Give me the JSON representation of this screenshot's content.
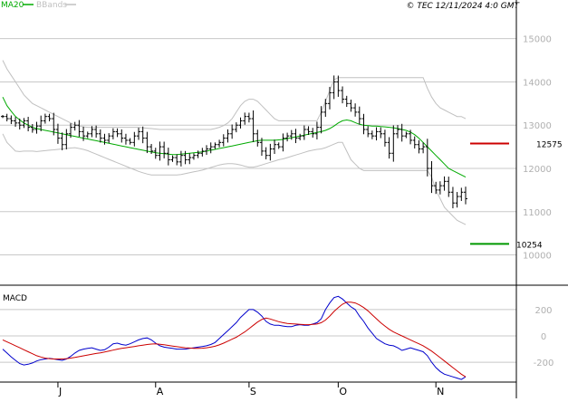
{
  "legend": {
    "ma_label": "MA20",
    "bbands_label": "BBands",
    "ma_color": "#00aa00",
    "bbands_color": "#c0c0c0"
  },
  "copyright": "© TEC 12/11/2024 4:0 GMT",
  "macd_label": "MACD",
  "chart_data": [
    {
      "type": "line",
      "title": "",
      "x_months": [
        {
          "label": "J",
          "index": 13
        },
        {
          "label": "A",
          "index": 36
        },
        {
          "label": "S",
          "index": 58
        },
        {
          "label": "O",
          "index": 79
        },
        {
          "label": "N",
          "index": 102
        }
      ],
      "ylim": [
        9300,
        15600
      ],
      "yticks": [
        10000,
        11000,
        12000,
        13000,
        14000,
        15000
      ],
      "ytick_labels": [
        "10000",
        "11000",
        "12000",
        "13000",
        "14000",
        "15000"
      ],
      "grid": true,
      "series": [
        {
          "name": "",
          "kind": "ohlc",
          "close": [
            13200,
            13150,
            13100,
            13050,
            13000,
            13100,
            12950,
            12900,
            12980,
            13100,
            13200,
            13150,
            12900,
            12700,
            12550,
            12800,
            12950,
            13000,
            12850,
            12750,
            12800,
            12900,
            12800,
            12700,
            12650,
            12750,
            12850,
            12800,
            12700,
            12650,
            12600,
            12750,
            12850,
            12700,
            12500,
            12400,
            12300,
            12500,
            12350,
            12200,
            12250,
            12150,
            12300,
            12200,
            12250,
            12300,
            12350,
            12400,
            12450,
            12500,
            12550,
            12600,
            12700,
            12800,
            12900,
            13000,
            13100,
            13200,
            13150,
            12800,
            12600,
            12400,
            12300,
            12450,
            12550,
            12500,
            12700,
            12750,
            12800,
            12700,
            12750,
            12900,
            12850,
            12800,
            12950,
            13300,
            13500,
            13750,
            14000,
            13800,
            13600,
            13500,
            13400,
            13300,
            13150,
            12900,
            12800,
            12750,
            12850,
            12800,
            12600,
            12350,
            12800,
            12900,
            12750,
            12800,
            12650,
            12550,
            12450,
            12500,
            12000,
            11600,
            11500,
            11600,
            11700,
            11450,
            11200,
            11350,
            11450,
            11300
          ],
          "color": "#000000"
        },
        {
          "name": "MA20",
          "kind": "line",
          "start": 0,
          "values": [
            13650,
            13450,
            13320,
            13200,
            13120,
            13050,
            13000,
            12950,
            12920,
            12900,
            12880,
            12860,
            12840,
            12820,
            12800,
            12780,
            12760,
            12740,
            12720,
            12700,
            12680,
            12660,
            12640,
            12620,
            12600,
            12580,
            12560,
            12540,
            12520,
            12500,
            12480,
            12460,
            12440,
            12420,
            12400,
            12380,
            12360,
            12350,
            12340,
            12330,
            12320,
            12320,
            12330,
            12340,
            12350,
            12360,
            12370,
            12380,
            12400,
            12420,
            12440,
            12460,
            12480,
            12500,
            12520,
            12540,
            12560,
            12580,
            12600,
            12620,
            12640,
            12650,
            12650,
            12650,
            12650,
            12660,
            12670,
            12690,
            12710,
            12730,
            12750,
            12770,
            12790,
            12810,
            12830,
            12850,
            12880,
            12920,
            12980,
            13050,
            13100,
            13120,
            13100,
            13060,
            13020,
            13000,
            12990,
            12980,
            12980,
            12970,
            12960,
            12950,
            12940,
            12920,
            12900,
            12880,
            12840,
            12780,
            12700,
            12600,
            12500,
            12400,
            12300,
            12200,
            12100,
            12000,
            11950,
            11900,
            11850,
            11800
          ],
          "color": "#00aa00"
        },
        {
          "name": "BBands",
          "kind": "line",
          "start": 0,
          "values": [
            14500,
            14300,
            14150,
            14000,
            13850,
            13700,
            13600,
            13500,
            13450,
            13400,
            13350,
            13300,
            13250,
            13200,
            13150,
            13100,
            13050,
            13000,
            12980,
            12960,
            12950,
            12950,
            12950,
            12950,
            12950,
            12950,
            12950,
            12950,
            12950,
            12950,
            12950,
            12950,
            12950,
            12940,
            12930,
            12920,
            12910,
            12900,
            12900,
            12900,
            12900,
            12900,
            12900,
            12900,
            12900,
            12900,
            12900,
            12900,
            12900,
            12900,
            12920,
            12950,
            12990,
            13050,
            13150,
            13300,
            13450,
            13550,
            13600,
            13600,
            13550,
            13450,
            13350,
            13250,
            13150,
            13100,
            13100,
            13100,
            13100,
            13100,
            13100,
            13100,
            13100,
            13100,
            13100,
            13300,
            13550,
            13800,
            14050,
            14100,
            14100,
            14100,
            14100,
            14100,
            14100,
            14100,
            14100,
            14100,
            14100,
            14100,
            14100,
            14100,
            14100,
            14100,
            14100,
            14100,
            14100,
            14100,
            14100,
            14100,
            13850,
            13650,
            13500,
            13400,
            13350,
            13300,
            13250,
            13200,
            13200,
            13150
          ],
          "color": "#c0c0c0"
        },
        {
          "name": "",
          "kind": "line",
          "start": 0,
          "values": [
            12800,
            12600,
            12500,
            12400,
            12390,
            12400,
            12400,
            12400,
            12390,
            12400,
            12410,
            12420,
            12430,
            12440,
            12450,
            12460,
            12470,
            12480,
            12460,
            12440,
            12410,
            12370,
            12330,
            12290,
            12250,
            12210,
            12170,
            12130,
            12090,
            12050,
            12010,
            11970,
            11930,
            11900,
            11870,
            11850,
            11850,
            11850,
            11850,
            11850,
            11850,
            11850,
            11860,
            11880,
            11900,
            11920,
            11940,
            11960,
            11990,
            12020,
            12050,
            12080,
            12100,
            12110,
            12110,
            12100,
            12080,
            12050,
            12030,
            12030,
            12050,
            12080,
            12110,
            12140,
            12170,
            12200,
            12220,
            12250,
            12280,
            12310,
            12340,
            12370,
            12400,
            12420,
            12440,
            12450,
            12480,
            12520,
            12560,
            12600,
            12600,
            12400,
            12200,
            12100,
            12000,
            11950,
            11950,
            11950,
            11950,
            11950,
            11950,
            11950,
            11950,
            11950,
            11950,
            11950,
            11950,
            11950,
            11950,
            11950,
            11950,
            11800,
            11500,
            11300,
            11100,
            11000,
            10900,
            10800,
            10750,
            10700
          ],
          "color": "#c0c0c0"
        }
      ],
      "annotations": [
        {
          "label": "12575",
          "value": 12575,
          "color": "#cc0000"
        },
        {
          "label": "10254",
          "value": 10254,
          "color": "#009900"
        }
      ]
    },
    {
      "type": "line",
      "title": "MACD",
      "ylim": [
        -350,
        350
      ],
      "yticks": [
        200,
        0,
        -200
      ],
      "ytick_labels": [
        "200",
        "0",
        "-200"
      ],
      "grid": true,
      "series": [
        {
          "name": "",
          "values": [
            -100,
            -130,
            -160,
            -185,
            -210,
            -220,
            -215,
            -205,
            -190,
            -180,
            -175,
            -170,
            -175,
            -180,
            -185,
            -175,
            -155,
            -130,
            -110,
            -100,
            -95,
            -90,
            -100,
            -110,
            -105,
            -85,
            -60,
            -55,
            -65,
            -70,
            -60,
            -45,
            -30,
            -20,
            -15,
            -30,
            -55,
            -75,
            -85,
            -90,
            -95,
            -100,
            -100,
            -100,
            -95,
            -90,
            -85,
            -80,
            -75,
            -65,
            -50,
            -20,
            10,
            40,
            70,
            100,
            140,
            170,
            200,
            200,
            180,
            150,
            110,
            90,
            80,
            80,
            75,
            70,
            70,
            80,
            85,
            80,
            80,
            90,
            100,
            130,
            200,
            250,
            290,
            300,
            280,
            250,
            220,
            200,
            150,
            110,
            60,
            20,
            -20,
            -40,
            -60,
            -70,
            -75,
            -90,
            -110,
            -100,
            -90,
            -100,
            -110,
            -120,
            -150,
            -200,
            -240,
            -270,
            -290,
            -300,
            -310,
            -320,
            -330,
            -310
          ],
          "color": "#0000cc"
        },
        {
          "name": "",
          "values": [
            -30,
            -45,
            -60,
            -75,
            -90,
            -105,
            -120,
            -135,
            -150,
            -160,
            -168,
            -172,
            -175,
            -175,
            -175,
            -172,
            -168,
            -163,
            -157,
            -151,
            -145,
            -139,
            -133,
            -128,
            -122,
            -115,
            -108,
            -100,
            -95,
            -90,
            -85,
            -80,
            -75,
            -70,
            -65,
            -62,
            -60,
            -63,
            -67,
            -72,
            -77,
            -82,
            -86,
            -90,
            -92,
            -94,
            -94,
            -93,
            -90,
            -85,
            -78,
            -68,
            -55,
            -40,
            -25,
            -10,
            10,
            30,
            55,
            80,
            105,
            125,
            135,
            128,
            118,
            108,
            100,
            95,
            92,
            90,
            88,
            86,
            85,
            87,
            90,
            100,
            120,
            150,
            185,
            215,
            240,
            255,
            255,
            250,
            235,
            215,
            190,
            160,
            130,
            100,
            75,
            50,
            30,
            15,
            0,
            -15,
            -30,
            -45,
            -60,
            -75,
            -95,
            -115,
            -140,
            -165,
            -190,
            -215,
            -240,
            -265,
            -290,
            -310
          ],
          "color": "#cc0000"
        }
      ]
    }
  ]
}
